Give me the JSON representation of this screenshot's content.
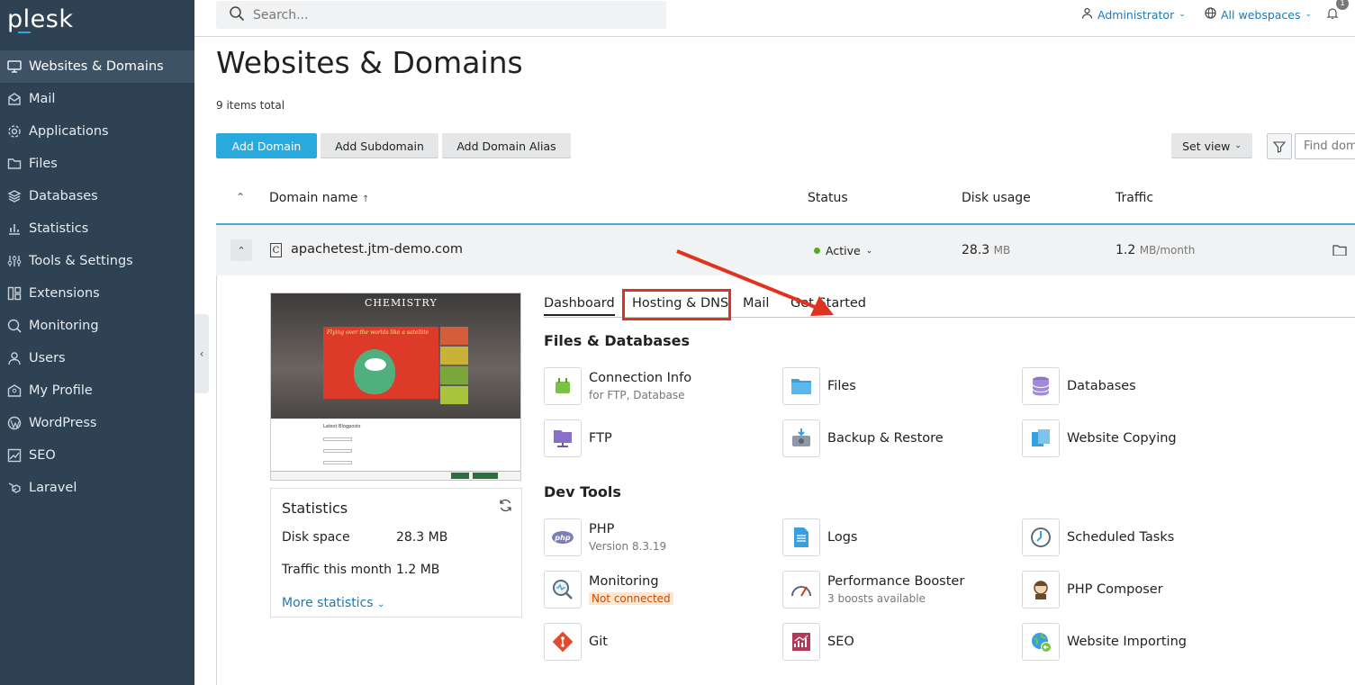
{
  "app": {
    "logo": "plesk"
  },
  "sidebar": {
    "items": [
      {
        "label": "Websites & Domains",
        "icon": "monitor-icon"
      },
      {
        "label": "Mail",
        "icon": "mail-icon"
      },
      {
        "label": "Applications",
        "icon": "gear-icon"
      },
      {
        "label": "Files",
        "icon": "folder-icon"
      },
      {
        "label": "Databases",
        "icon": "database-icon"
      },
      {
        "label": "Statistics",
        "icon": "bar-chart-icon"
      },
      {
        "label": "Tools & Settings",
        "icon": "sliders-icon"
      },
      {
        "label": "Extensions",
        "icon": "extensions-icon"
      },
      {
        "label": "Monitoring",
        "icon": "monitoring-icon"
      },
      {
        "label": "Users",
        "icon": "user-icon"
      },
      {
        "label": "My Profile",
        "icon": "profile-icon"
      },
      {
        "label": "WordPress",
        "icon": "wordpress-icon"
      },
      {
        "label": "SEO",
        "icon": "seo-icon"
      },
      {
        "label": "Laravel",
        "icon": "laravel-icon"
      }
    ],
    "active": "Websites & Domains"
  },
  "topbar": {
    "search_placeholder": "Search...",
    "user": "Administrator",
    "webspaces": "All webspaces",
    "notification_badge": "1"
  },
  "page": {
    "title": "Websites & Domains",
    "items_total": "9 items total",
    "buttons": {
      "add_domain": "Add Domain",
      "add_subdomain": "Add Subdomain",
      "add_domain_alias": "Add Domain Alias",
      "set_view": "Set view"
    },
    "find_placeholder": "Find dom"
  },
  "table": {
    "headers": {
      "domain": "Domain name",
      "status": "Status",
      "disk": "Disk usage",
      "traffic": "Traffic"
    },
    "row": {
      "domain": "apachetest.jtm-demo.com",
      "status": "Active",
      "disk_value": "28.3",
      "disk_unit": "MB",
      "traffic_value": "1.2",
      "traffic_unit": "MB/month"
    }
  },
  "panel": {
    "thumbnail": {
      "site_title": "CHEMISTRY",
      "banner_text": "Flying over the worlds like a satellite",
      "form_title": "Latest Blogposts"
    },
    "stats": {
      "title": "Statistics",
      "disk_label": "Disk space",
      "disk_value": "28.3 MB",
      "traffic_label": "Traffic this month",
      "traffic_value": "1.2 MB",
      "more": "More statistics"
    },
    "tabs": [
      "Dashboard",
      "Hosting & DNS",
      "Mail",
      "Get Started"
    ],
    "sections": [
      {
        "title": "Files & Databases",
        "tools": [
          {
            "name": "Connection Info",
            "sub": "for FTP, Database"
          },
          {
            "name": "Files",
            "sub": ""
          },
          {
            "name": "Databases",
            "sub": ""
          },
          {
            "name": "FTP",
            "sub": ""
          },
          {
            "name": "Backup & Restore",
            "sub": ""
          },
          {
            "name": "Website Copying",
            "sub": ""
          }
        ]
      },
      {
        "title": "Dev Tools",
        "tools": [
          {
            "name": "PHP",
            "sub": "Version 8.3.19"
          },
          {
            "name": "Logs",
            "sub": ""
          },
          {
            "name": "Scheduled Tasks",
            "sub": ""
          },
          {
            "name": "Monitoring",
            "sub": "Not connected"
          },
          {
            "name": "Performance Booster",
            "sub": "3 boosts available"
          },
          {
            "name": "PHP Composer",
            "sub": ""
          },
          {
            "name": "Git",
            "sub": ""
          },
          {
            "name": "SEO",
            "sub": ""
          },
          {
            "name": "Website Importing",
            "sub": ""
          }
        ]
      }
    ]
  },
  "colors": {
    "sidebar_bg": "#2f4254",
    "accent": "#28aade",
    "link": "#1d7ab3",
    "annotation_red": "#e0321e",
    "status_active": "#58a829"
  }
}
